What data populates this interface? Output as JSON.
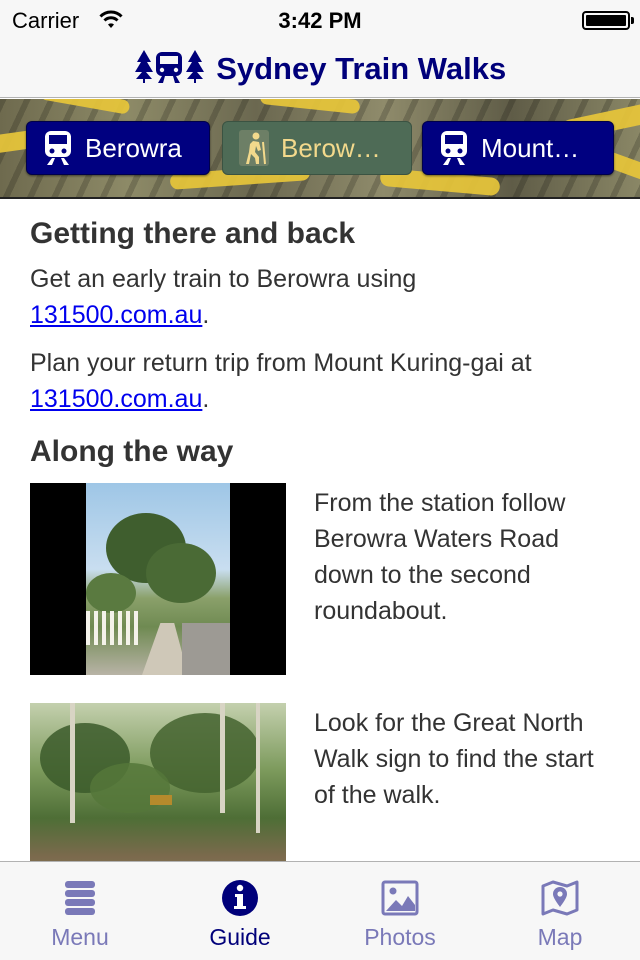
{
  "status_bar": {
    "carrier": "Carrier",
    "time": "3:42 PM"
  },
  "nav": {
    "title": "Sydney Train Walks"
  },
  "segments": [
    {
      "label": "Berowra",
      "icon": "train-icon",
      "selected": false
    },
    {
      "label": "Berow…",
      "icon": "hiker-icon",
      "selected": true
    },
    {
      "label": "Mount…",
      "icon": "train-icon",
      "selected": false
    }
  ],
  "content": {
    "getting_there_heading": "Getting there and back",
    "para1_text": "Get an early train to Berowra using",
    "para1_link": "131500.com.au",
    "para1_suffix": ".",
    "para2_text": "Plan your return trip from Mount Kuring-gai at",
    "para2_link": "131500.com.au",
    "para2_suffix": ".",
    "along_heading": "Along the way",
    "steps": [
      {
        "text": "From the station follow Berowra Waters Road down to the second roundabout."
      },
      {
        "text": "Look for the Great North Walk sign to find the start of the walk."
      }
    ]
  },
  "tabs": [
    {
      "label": "Menu",
      "icon": "menu-icon",
      "selected": false
    },
    {
      "label": "Guide",
      "icon": "info-icon",
      "selected": true
    },
    {
      "label": "Photos",
      "icon": "photos-icon",
      "selected": false
    },
    {
      "label": "Map",
      "icon": "map-icon",
      "selected": false
    }
  ],
  "colors": {
    "brand": "#00007a",
    "tab_inactive": "#7a79b8",
    "link": "#0000ee",
    "button_dark": "#000080",
    "button_active": "#4e6b56"
  }
}
